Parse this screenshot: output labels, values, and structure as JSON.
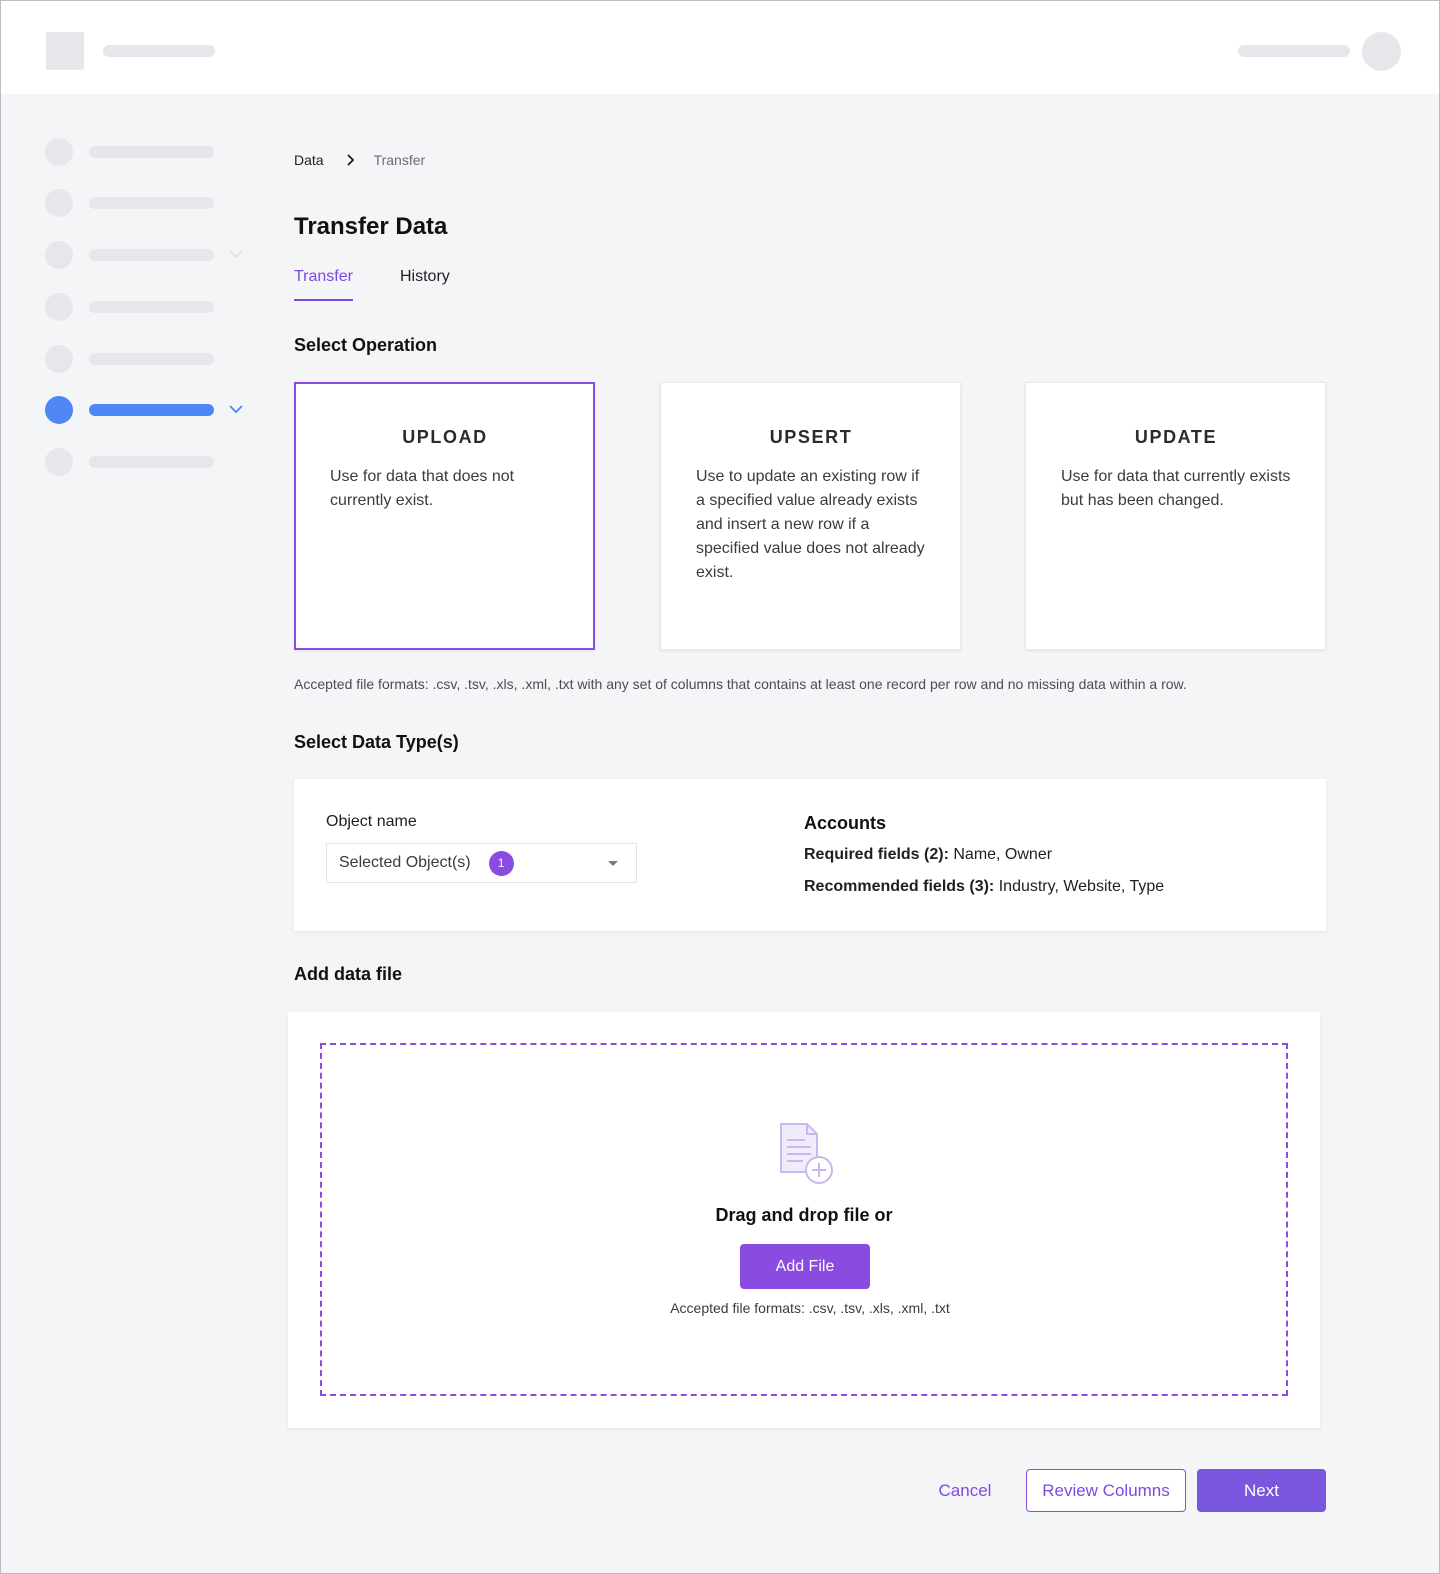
{
  "breadcrumb": {
    "root": "Data",
    "current": "Transfer"
  },
  "page": {
    "title": "Transfer Data"
  },
  "tabs": [
    {
      "label": "Transfer",
      "active": true
    },
    {
      "label": "History",
      "active": false
    }
  ],
  "operation": {
    "section_title": "Select Operation",
    "cards": [
      {
        "title": "UPLOAD",
        "description": "Use for data that does not currently exist.",
        "selected": true
      },
      {
        "title": "UPSERT",
        "description": "Use to update an existing row if a specified value already exists and insert a new row if a specified value does not already exist.",
        "selected": false
      },
      {
        "title": "UPDATE",
        "description": "Use for data that currently exists but has been changed.",
        "selected": false
      }
    ],
    "formats_note": "Accepted file formats: .csv, .tsv, .xls, .xml, .txt with any set of columns that contains at least one record per row and no missing data within a row."
  },
  "data_type": {
    "section_title": "Select Data Type(s)",
    "object_label": "Object name",
    "select_value": "Selected Object(s)",
    "select_count": "1",
    "object_title": "Accounts",
    "required_label": "Required fields (2):",
    "required_values": "Name, Owner",
    "recommended_label": "Recommended fields (3):",
    "recommended_values": "Industry, Website, Type"
  },
  "file": {
    "section_title": "Add data file",
    "drop_text": "Drag and drop file or",
    "add_button": "Add File",
    "formats": "Accepted file formats: .csv, .tsv, .xls, .xml, .txt"
  },
  "footer": {
    "cancel": "Cancel",
    "review": "Review Columns",
    "next": "Next"
  },
  "colors": {
    "accent": "#8a4be0",
    "nav_active": "#4f87f6",
    "next_button": "#7a55dd"
  }
}
